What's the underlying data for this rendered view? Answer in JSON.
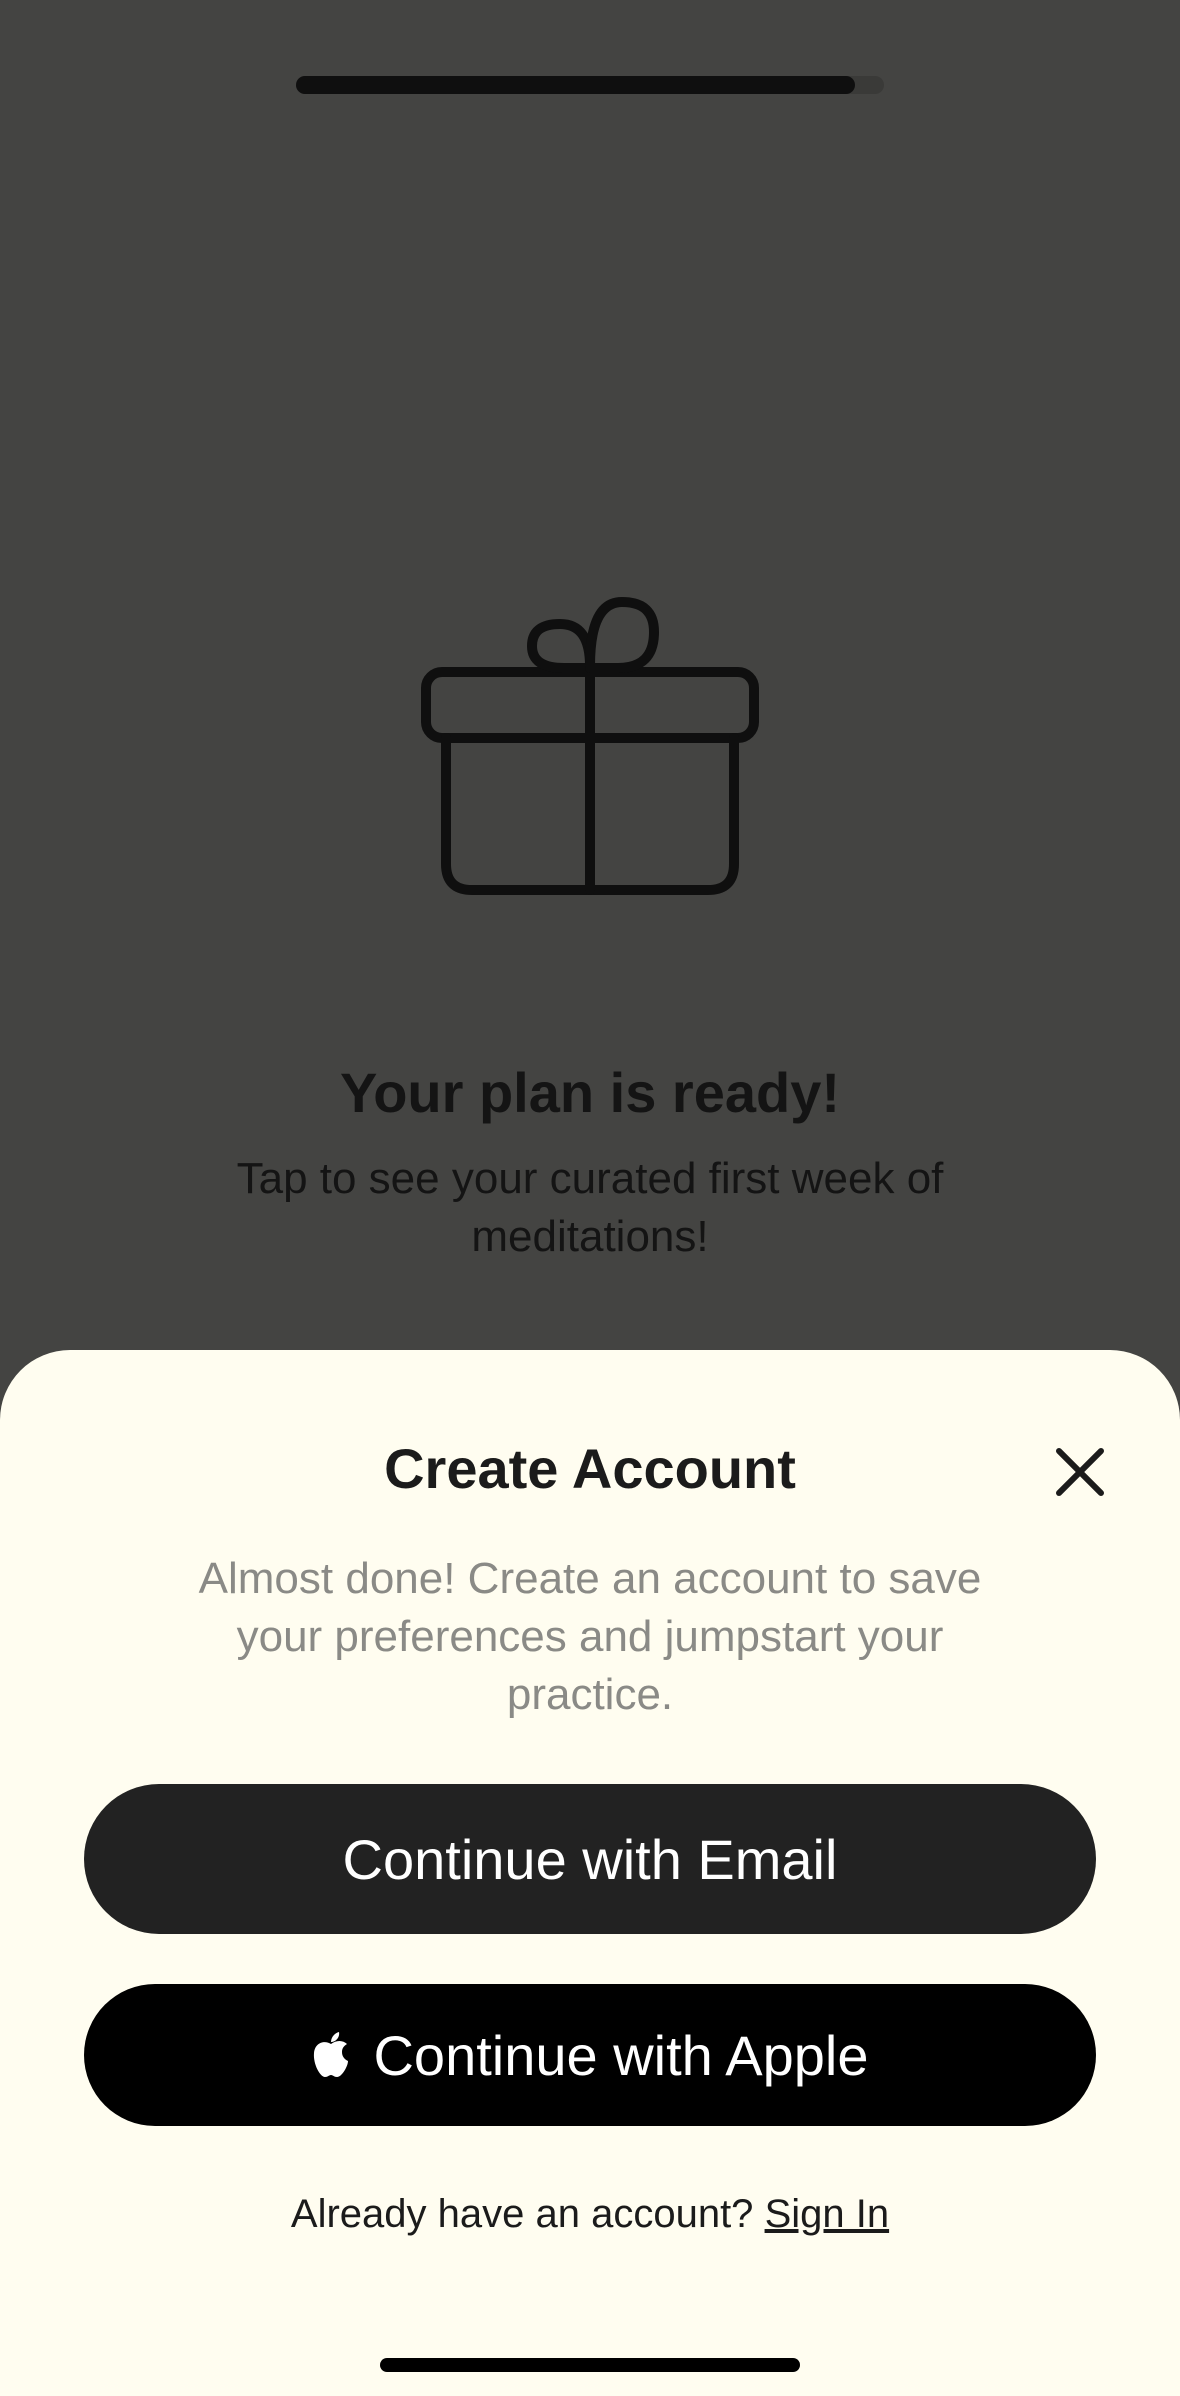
{
  "onboarding": {
    "progress": 0.95,
    "gift_icon": "gift-icon",
    "title": "Your plan is ready!",
    "subtitle": "Tap to see your curated first week of meditations!"
  },
  "sheet": {
    "title": "Create Account",
    "close_icon": "close-icon",
    "subtitle": "Almost done! Create an account to save your preferences and jumpstart your practice.",
    "email_button": "Continue with Email",
    "apple_icon": "apple-icon",
    "apple_button": "Continue with Apple",
    "have_account": "Already have an account?",
    "sign_in": "Sign In"
  },
  "colors": {
    "overlay_bg": "#444442",
    "sheet_bg": "#fffdf0",
    "email_button_bg": "#222222",
    "apple_button_bg": "#000000",
    "subtitle_text": "#8a8a86"
  }
}
